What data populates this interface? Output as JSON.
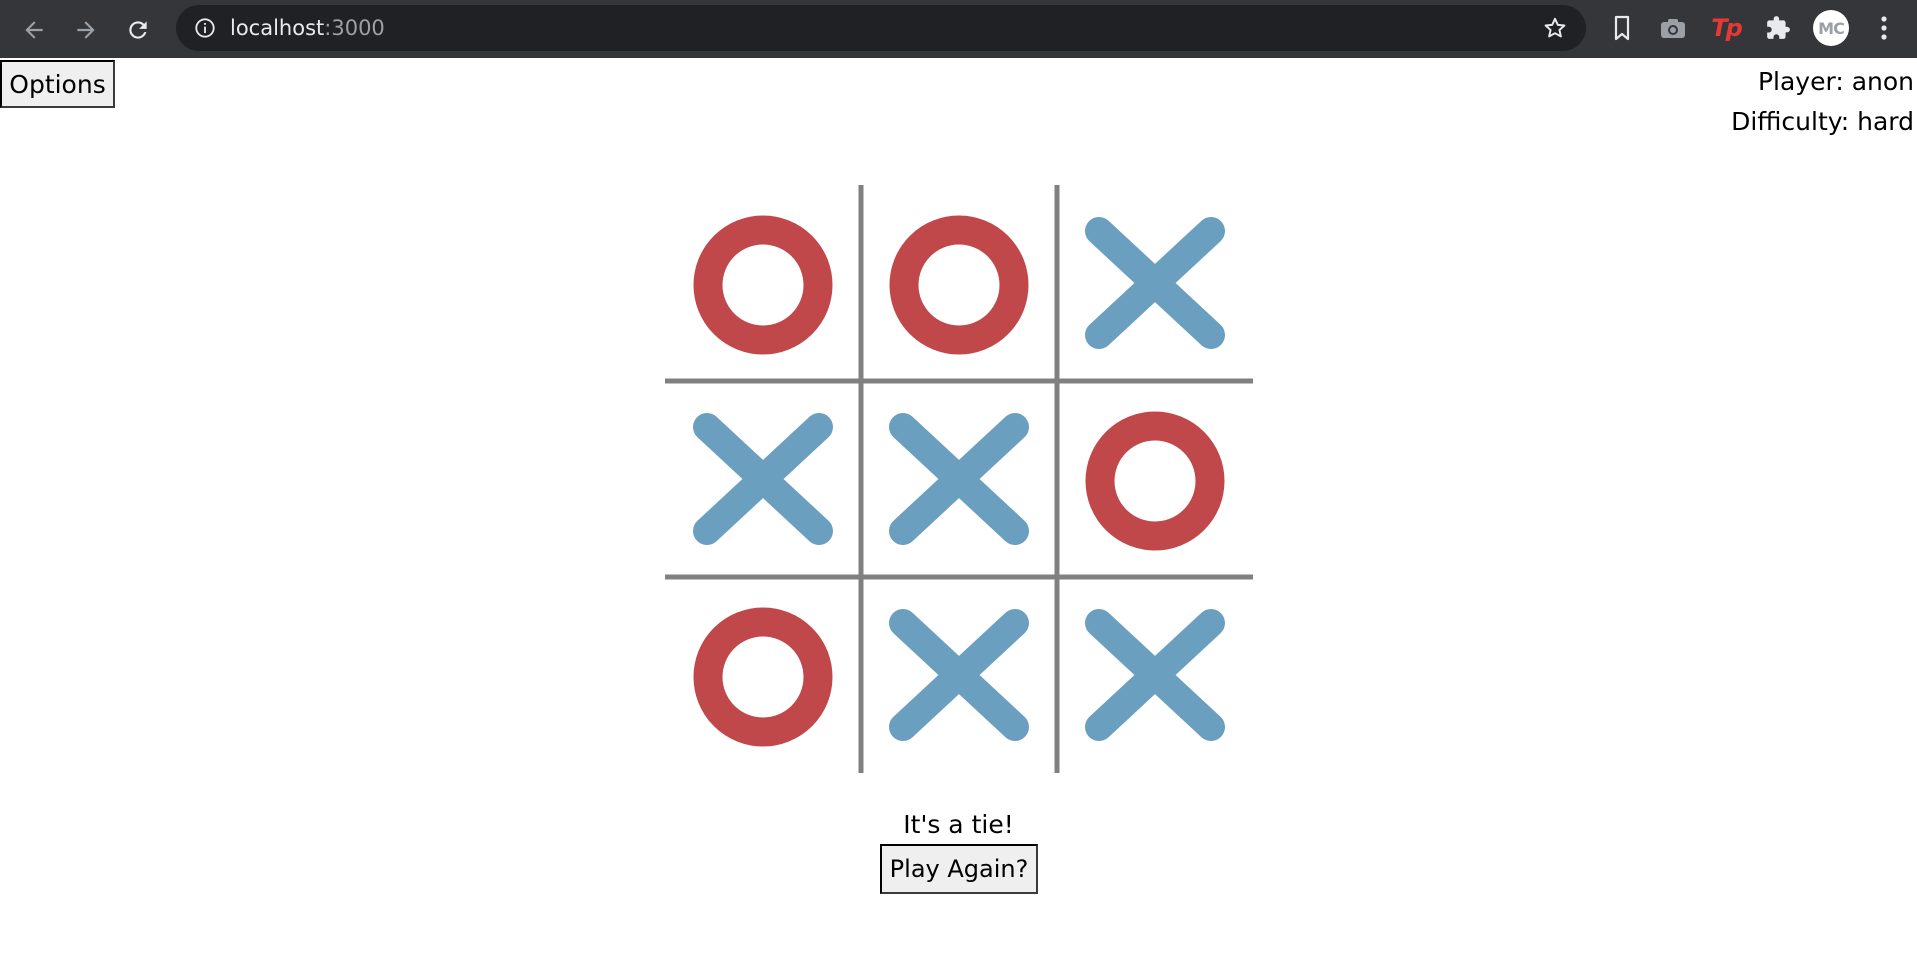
{
  "browser": {
    "url_host": "localhost",
    "url_port": ":3000",
    "avatar_initials": "MC",
    "extension_label": "Tp",
    "icons": [
      "back-arrow-icon",
      "forward-arrow-icon",
      "reload-icon",
      "info-icon",
      "star-icon",
      "bookmark-icon",
      "camera-icon",
      "puzzle-icon",
      "kebab-menu-icon"
    ]
  },
  "header": {
    "options_label": "Options",
    "player_text": "Player: anon",
    "difficulty_text": "Difficulty: hard"
  },
  "game": {
    "board": [
      "O",
      "O",
      "X",
      "X",
      "X",
      "O",
      "O",
      "X",
      "X"
    ],
    "x_color": "#6a9fbf",
    "o_color": "#c0474a",
    "grid_color": "#808080",
    "status_text": "It's a tie!",
    "play_again_label": "Play Again?"
  }
}
